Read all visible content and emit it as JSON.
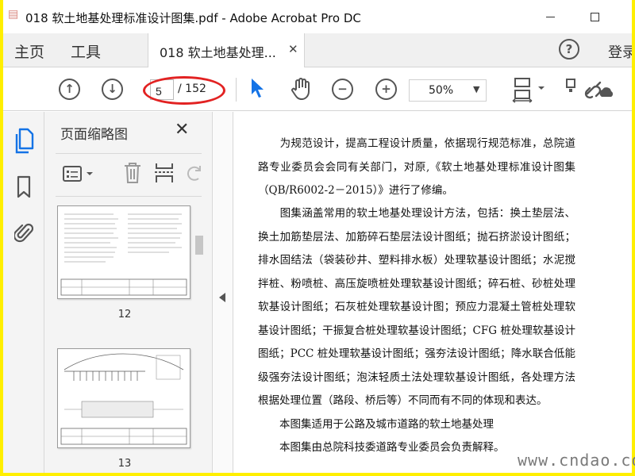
{
  "window": {
    "title": "018 软土地基处理标准设计图集.pdf - Adobe Acrobat Pro DC"
  },
  "tabs": {
    "home": "主页",
    "tools": "工具",
    "document": "018 软土地基处理...",
    "signin": "登录"
  },
  "toolbar": {
    "page_current": "5",
    "page_total": "/ 152",
    "zoom": "50%",
    "icons": [
      "prev-page-icon",
      "next-page-icon",
      "select-pointer-icon",
      "hand-tool-icon",
      "zoom-out-icon",
      "zoom-in-icon",
      "page-fit-icon",
      "share-icon",
      "link-icon"
    ]
  },
  "thumbnails_panel": {
    "title": "页面缩略图",
    "pages": [
      {
        "number": "12"
      },
      {
        "number": "13"
      }
    ]
  },
  "document": {
    "paragraphs": [
      "　　为规范设计，提高工程设计质量，依据现行规范标准，总院道路专业委员会会同有关部门，对原,《软土地基处理标准设计图集（QB/R6002-2－2015）》进行了修编。",
      "　　图集涵盖常用的软土地基处理设计方法，包括：换土垫层法、换土加筋垫层法、加筋碎石垫层法设计图纸；抛石挤淤设计图纸；排水固结法（袋装砂井、塑料排水板）处理软基设计图纸；水泥搅拌桩、粉喷桩、高压旋喷桩处理软基设计图纸；碎石桩、砂桩处理软基设计图纸；石灰桩处理软基设计图；预应力混凝土管桩处理软基设计图纸；干振复合桩处理软基设计图纸；CFG 桩处理软基设计图纸；PCC 桩处理软基设计图纸；强夯法设计图纸；降水联合低能级强夯法设计图纸；泡沫轻质土法处理软基设计图纸，各处理方法根据处理位置（路段、桥后等）不同而有不同的体现和表达。",
      "　　本图集适用于公路及城市道路的软土地基处理",
      "　　本图集由总院科技委道路专业委员会负责解释。"
    ]
  },
  "watermark": "www.cndao.com",
  "colors": {
    "highlight_ellipse": "#e22222",
    "pointer_blue": "#1473e6",
    "frame_yellow": "#ffef00"
  }
}
